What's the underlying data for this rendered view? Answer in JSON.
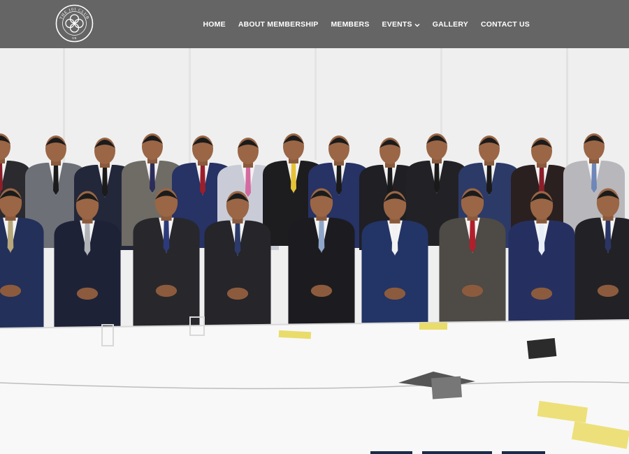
{
  "brand": {
    "logo_top_text": "THE 101 CLUB",
    "logo_bottom_text": "UK"
  },
  "nav": {
    "items": [
      {
        "label": "HOME"
      },
      {
        "label": "ABOUT MEMBERSHIP"
      },
      {
        "label": "MEMBERS"
      },
      {
        "label": "EVENTS",
        "has_dropdown": true
      },
      {
        "label": "GALLERY"
      },
      {
        "label": "CONTACT US"
      }
    ]
  },
  "hero": {
    "image_subject": "group-photo-of-members-in-suits-seated-at-conference-table"
  },
  "colors": {
    "navbar_bg": "#464646",
    "nav_text": "#ffffff",
    "table_white": "#f7f7f7",
    "suit_dark": "#1f2230",
    "suit_navy": "#24305a"
  },
  "icons": {
    "logo": "club-logo-icon",
    "dropdown": "chevron-down-icon"
  }
}
